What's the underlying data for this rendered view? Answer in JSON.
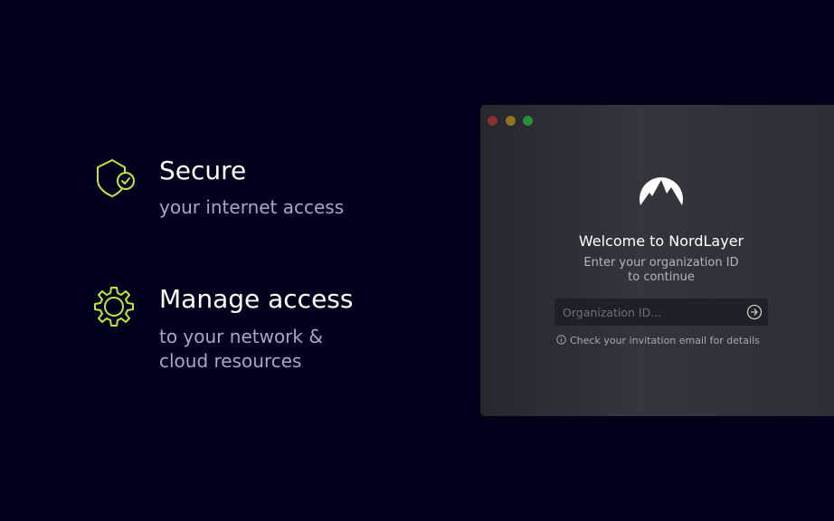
{
  "features": {
    "secure": {
      "title": "Secure",
      "subtitle": "your internet access",
      "icon": "shield-check-icon"
    },
    "manage": {
      "title": "Manage access",
      "subtitle_line1": "to your network &",
      "subtitle_line2": "cloud resources",
      "icon": "gear-icon"
    }
  },
  "window": {
    "welcome": "Welcome to NordLayer",
    "instruction_line1": "Enter your organization ID",
    "instruction_line2": "to continue",
    "org_input": {
      "placeholder": "Organization ID...",
      "value": ""
    },
    "hint": "Check your invitation email for details",
    "logo_icon": "nordlayer-mountain-icon"
  },
  "colors": {
    "background": "#03021e",
    "accent": "#c6e33b",
    "window_bg": "#2f3238",
    "subtitle": "#a6a6c9"
  }
}
